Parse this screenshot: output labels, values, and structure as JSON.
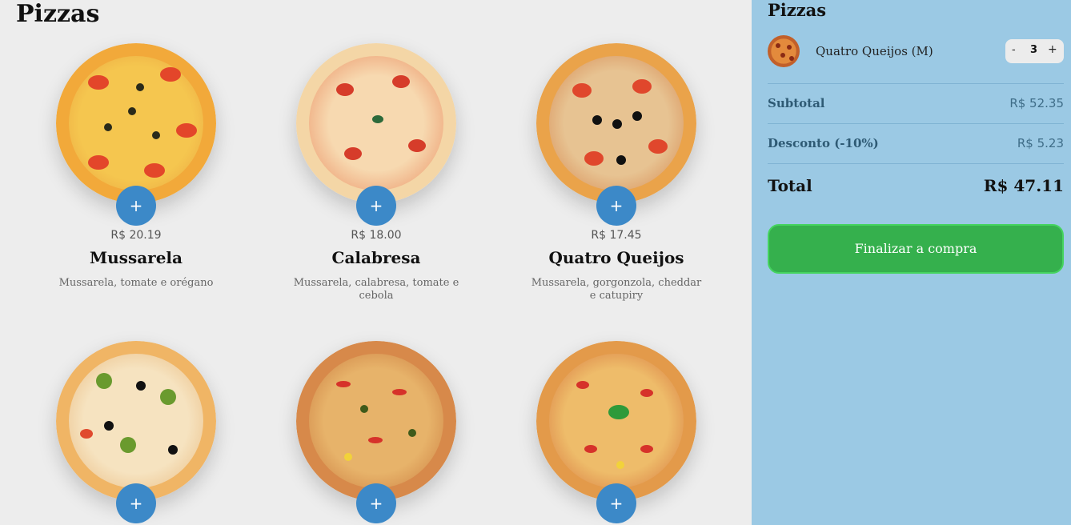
{
  "main": {
    "title": "Pizzas",
    "add_label": "+",
    "pizzas": [
      {
        "price": "R$ 20.19",
        "name": "Mussarela",
        "desc": "Mussarela, tomate e orégano"
      },
      {
        "price": "R$ 18.00",
        "name": "Calabresa",
        "desc": "Mussarela, calabresa, tomate e cebola"
      },
      {
        "price": "R$ 17.45",
        "name": "Quatro Queijos",
        "desc": "Mussarela, gorgonzola, cheddar e catupiry"
      },
      {
        "price": "",
        "name": "",
        "desc": ""
      },
      {
        "price": "",
        "name": "",
        "desc": ""
      },
      {
        "price": "",
        "name": "",
        "desc": ""
      }
    ]
  },
  "cart": {
    "title": "Pizzas",
    "item": {
      "name": "Quatro Queijos (M)",
      "qty": "3",
      "minus": "-",
      "plus": "+"
    },
    "subtotal_label": "Subtotal",
    "subtotal_value": "R$ 52.35",
    "discount_label": "Desconto (-10%)",
    "discount_value": "R$ 5.23",
    "total_label": "Total",
    "total_value": "R$ 47.11",
    "checkout_label": "Finalizar a compra"
  },
  "colors": {
    "accent_blue": "#3c89c8",
    "cart_bg": "#9bc9e4",
    "checkout_green": "#35b04d"
  }
}
